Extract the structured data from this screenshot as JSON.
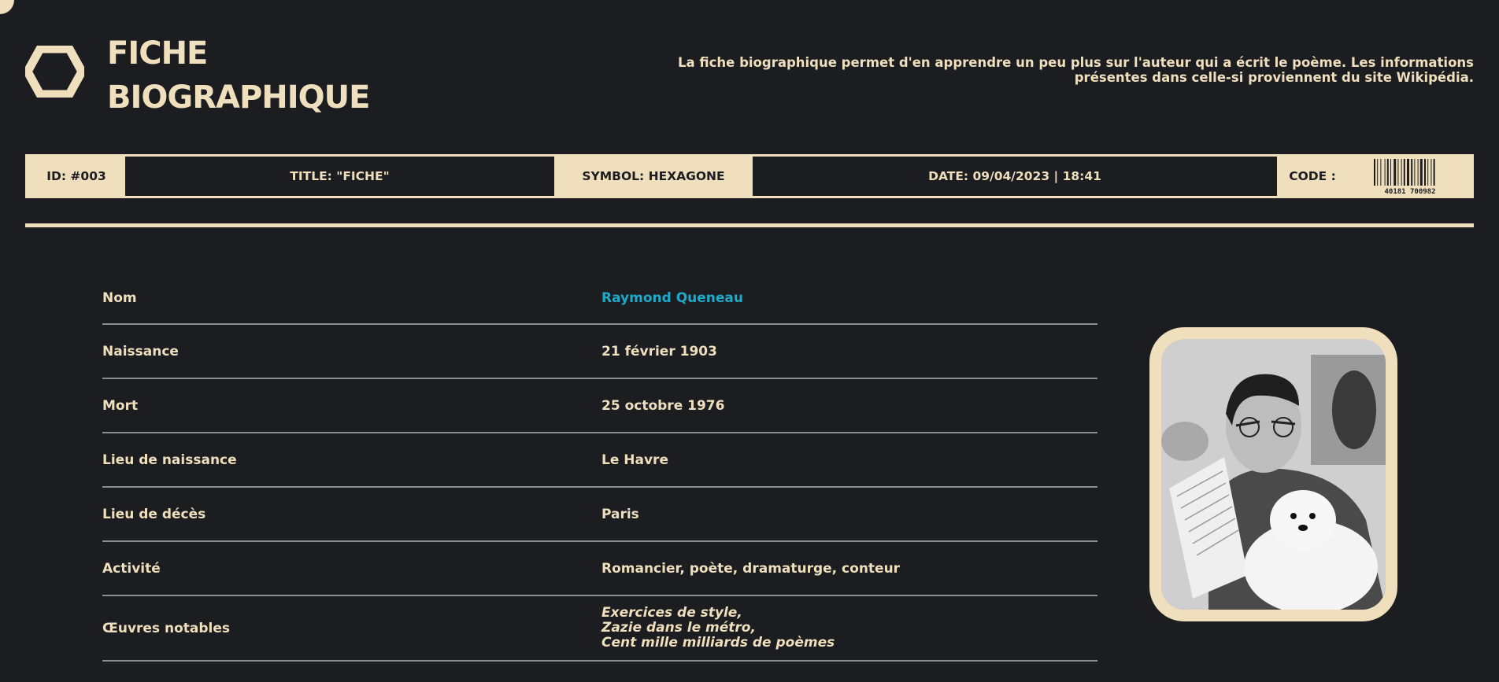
{
  "header": {
    "title_line1": "FICHE",
    "title_line2": "BIOGRAPHIQUE",
    "intro_line1": "La fiche biographique permet d'en apprendre un peu plus sur l'auteur qui a écrit le poème. Les informations",
    "intro_line2": "présentes dans celle-si proviennent du site Wikipédia."
  },
  "infobar": {
    "id": "ID: #003",
    "title": "TITLE: \"FICHE\"",
    "symbol": "SYMBOL: HEXAGONE",
    "date": "DATE: 09/04/2023 | 18:41",
    "code_label": "CODE :",
    "barcode_number": "40181 700982"
  },
  "rows": [
    {
      "label": "Nom",
      "value": "Raymond Queneau"
    },
    {
      "label": "Naissance",
      "value": "21 février 1903"
    },
    {
      "label": "Mort",
      "value": "25 octobre 1976"
    },
    {
      "label": "Lieu de naissance",
      "value": "Le Havre"
    },
    {
      "label": "Lieu de décès",
      "value": "Paris"
    },
    {
      "label": "Activité",
      "value": "Romancier, poète, dramaturge, conteur"
    },
    {
      "label": "Œuvres notables",
      "works": [
        "Exercices de style,",
        "Zazie dans le métro,",
        "Cent mille milliards de poèmes"
      ]
    }
  ],
  "colors": {
    "background": "#1c1d21",
    "cream": "#efdfbd",
    "link": "#1eaac8",
    "divider": "#8b8d92"
  },
  "icons": {
    "logo": "hexagon-icon"
  }
}
